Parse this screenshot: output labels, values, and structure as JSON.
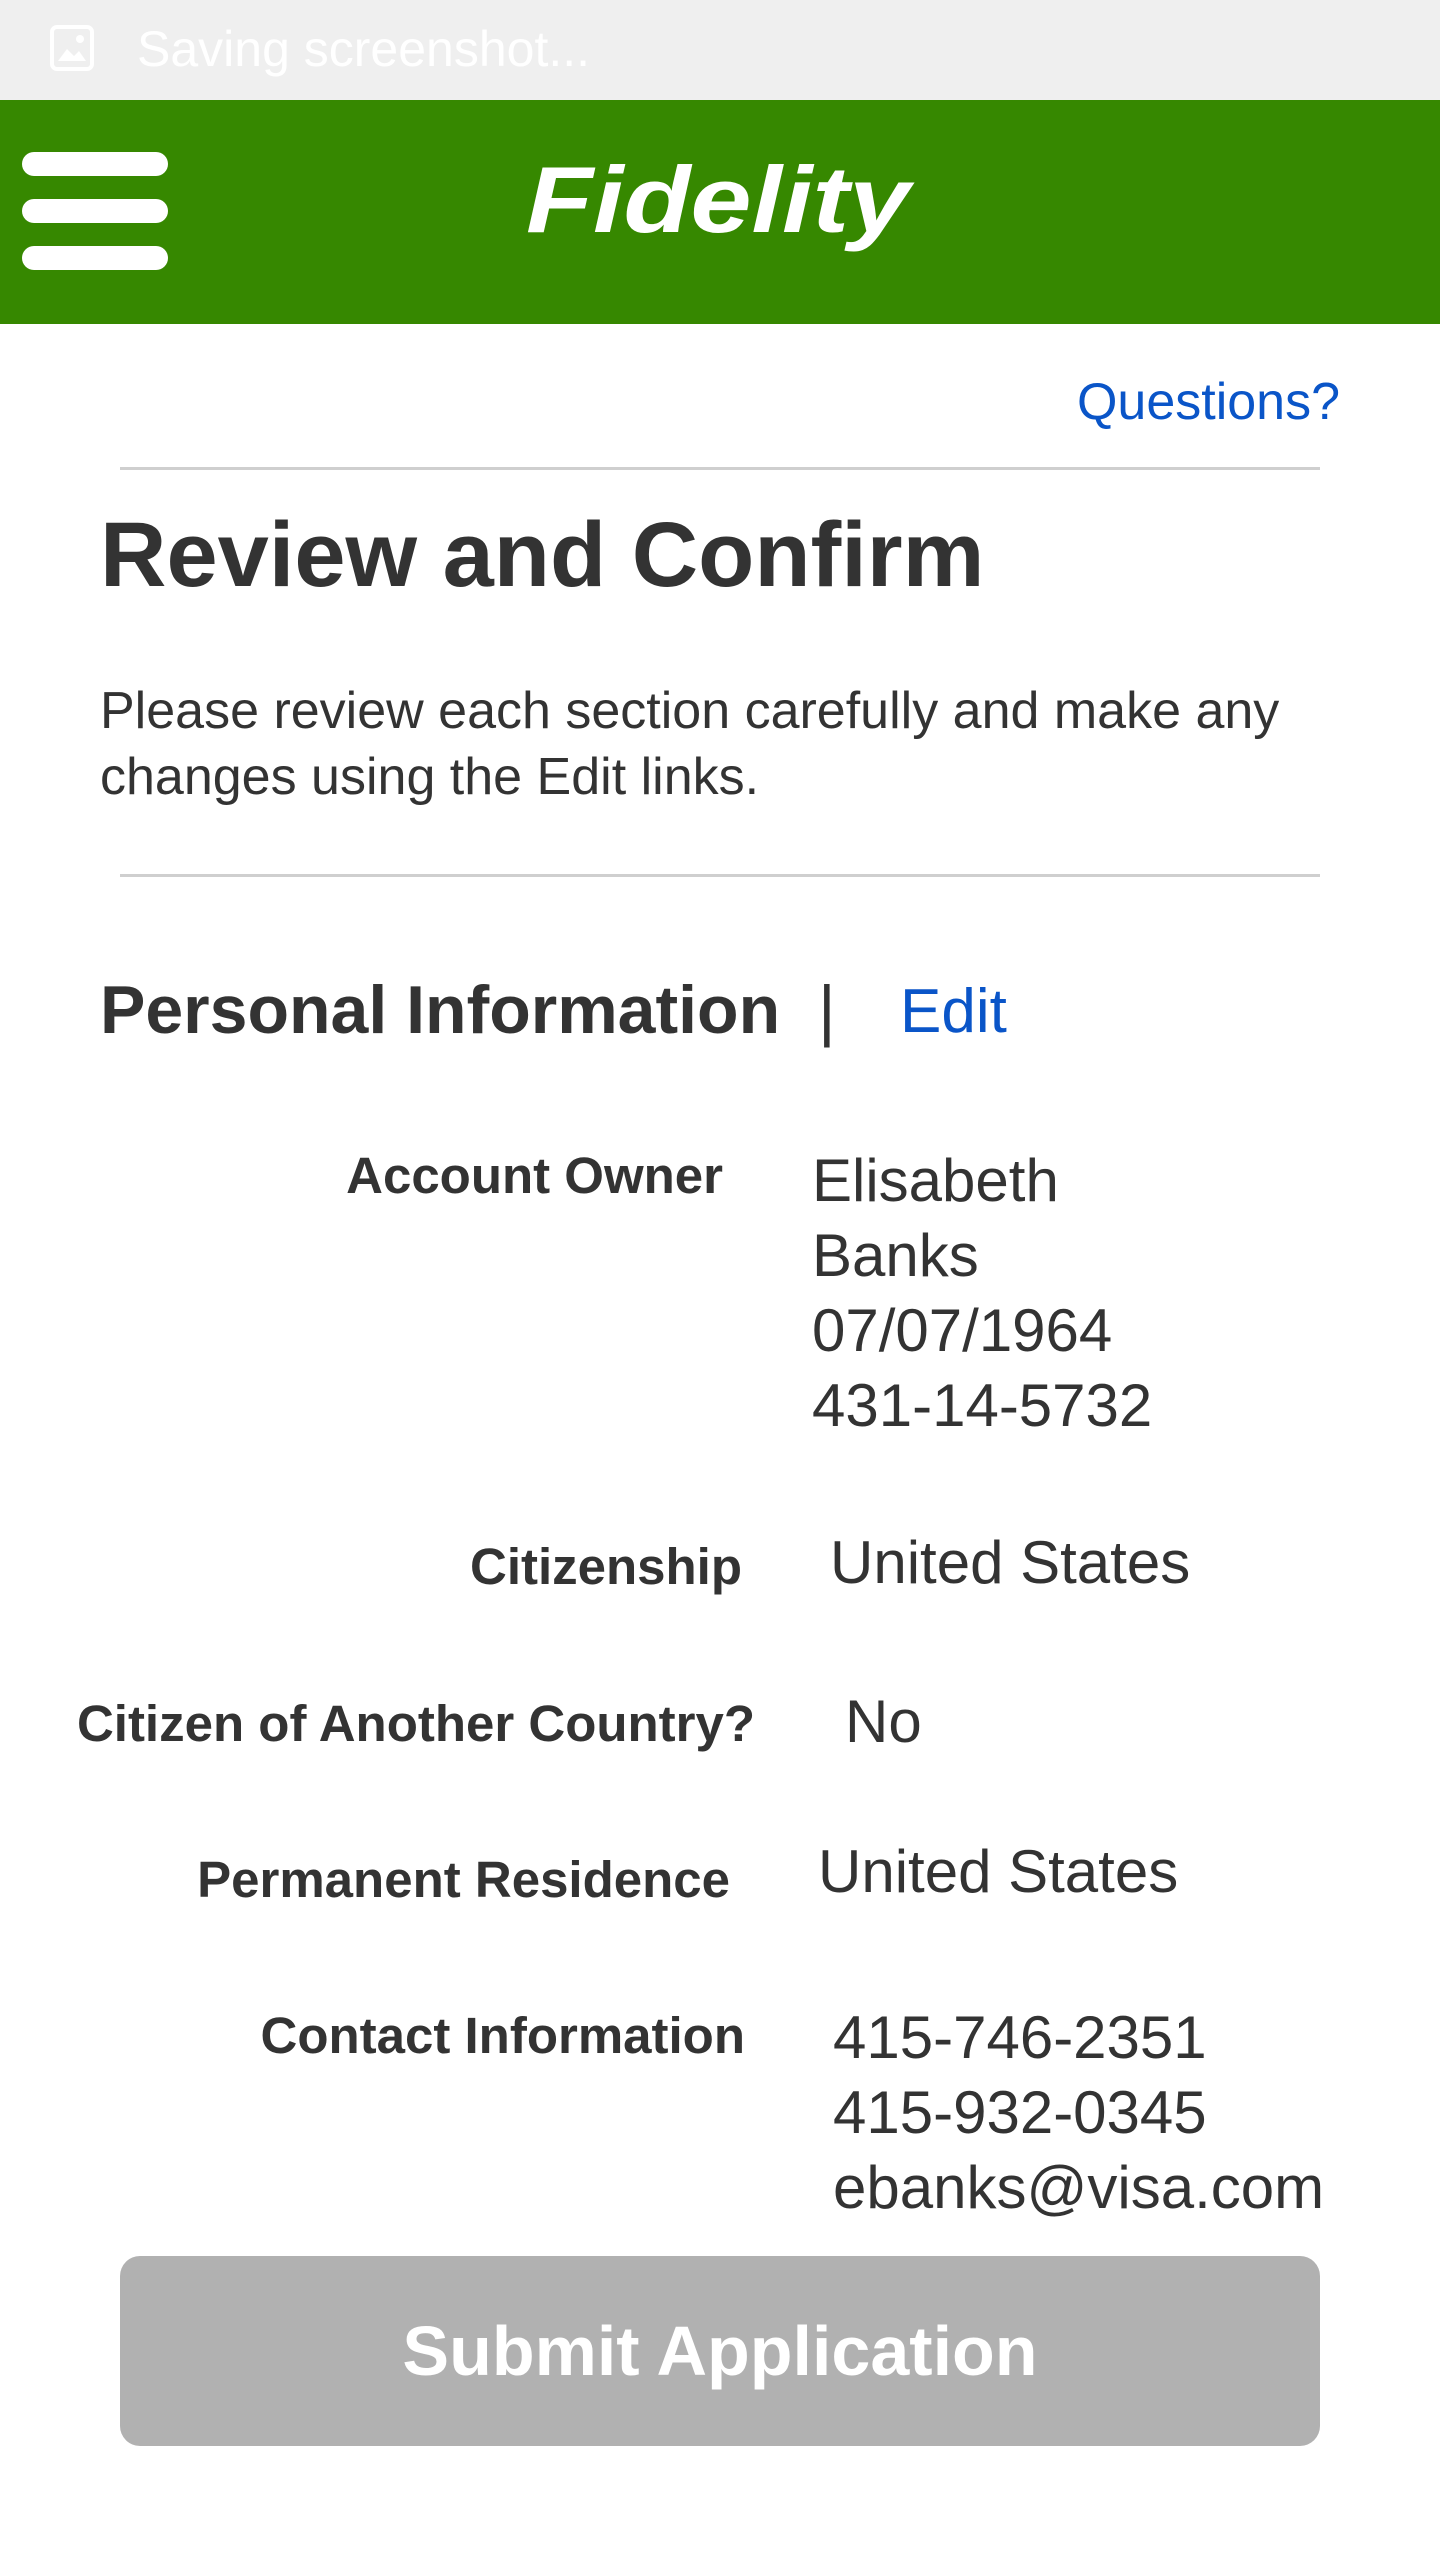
{
  "status_bar": {
    "text": "Saving screenshot...",
    "icon": "image-icon"
  },
  "header": {
    "menu_icon": "hamburger-menu-icon",
    "logo_text": "Fidelity",
    "brand_color": "#368800"
  },
  "questions_link": "Questions?",
  "page": {
    "title": "Review and Confirm",
    "instructions": "Please review each section carefully and make any changes using the Edit links."
  },
  "personal_info": {
    "title": "Personal Information",
    "separator": "|",
    "edit_label": "Edit",
    "account_owner": {
      "label": "Account Owner",
      "first_name": "Elisabeth",
      "last_name": "Banks",
      "dob": "07/07/1964",
      "ssn": "431-14-5732"
    },
    "citizenship": {
      "label": "Citizenship",
      "value": "United States"
    },
    "other_citizenship": {
      "label": "Citizen of Another Country?",
      "value": "No"
    },
    "permanent_residence": {
      "label": "Permanent Residence",
      "value": "United States"
    },
    "contact": {
      "label": "Contact Information",
      "phone_1": "415-746-2351",
      "phone_2": "415-932-0345",
      "email": "ebanks@visa.com"
    }
  },
  "submit_label": "Submit Application",
  "colors": {
    "link": "#0a55c8",
    "button_disabled": "#b1b1b1",
    "text": "#333333"
  }
}
